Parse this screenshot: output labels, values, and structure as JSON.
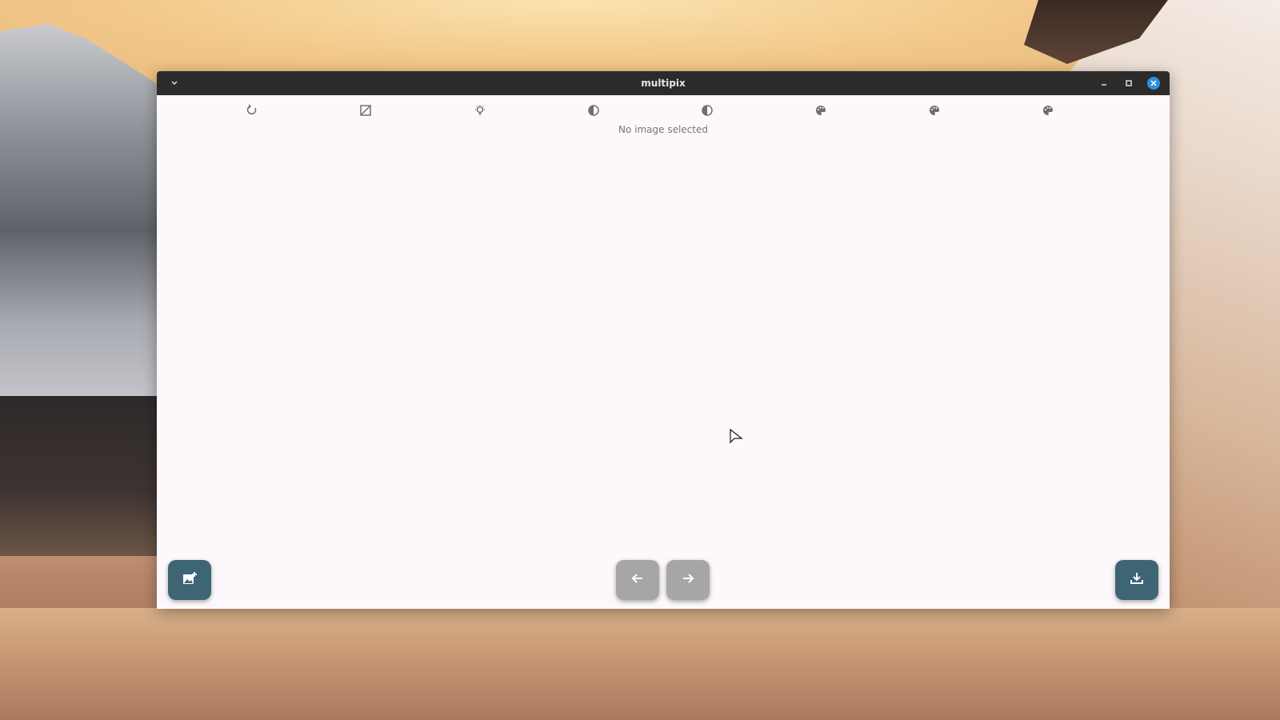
{
  "window": {
    "title": "multipix"
  },
  "titlebar": {
    "menu_icon": "chevron-down-icon",
    "minimize_icon": "minimize-icon",
    "maximize_icon": "maximize-icon",
    "close_icon": "close-icon",
    "close_color": "#2d8fe0"
  },
  "toolbar": {
    "tools": [
      {
        "name": "rotate-icon",
        "glyph": "↻"
      },
      {
        "name": "crop-icon",
        "glyph": "⊿"
      },
      {
        "name": "brightness-icon",
        "glyph": "💡"
      },
      {
        "name": "contrast-icon",
        "glyph": "◐"
      },
      {
        "name": "contrast-alt-icon",
        "glyph": "◐"
      },
      {
        "name": "palette-icon",
        "glyph": "🎨"
      },
      {
        "name": "palette-alt-icon",
        "glyph": "🎨"
      },
      {
        "name": "palette-third-icon",
        "glyph": "🎨"
      }
    ]
  },
  "main": {
    "status_text": "No image selected"
  },
  "actions": {
    "open_image_icon": "add-image-icon",
    "prev_icon": "arrow-left-icon",
    "next_icon": "arrow-right-icon",
    "save_icon": "download-icon",
    "accent_color": "#3e6574",
    "disabled_color": "#a6a6a6"
  }
}
